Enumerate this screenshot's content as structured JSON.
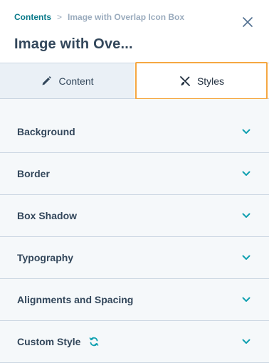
{
  "breadcrumb": {
    "parent": "Contents",
    "separator": ">",
    "current": "Image with Overlap Icon Box"
  },
  "title": "Image with Ove...",
  "tabs": [
    {
      "label": "Content",
      "icon": "pencil-icon",
      "active": false
    },
    {
      "label": "Styles",
      "icon": "brush-cross-icon",
      "active": true
    }
  ],
  "sections": [
    {
      "label": "Background",
      "icon": "chevron-down-icon"
    },
    {
      "label": "Border",
      "icon": "chevron-down-icon"
    },
    {
      "label": "Box Shadow",
      "icon": "chevron-down-icon"
    },
    {
      "label": "Typography",
      "icon": "chevron-down-icon"
    },
    {
      "label": "Alignments and Spacing",
      "icon": "chevron-down-icon"
    },
    {
      "label": "Custom Style",
      "icon": "chevron-down-icon",
      "badge_icon": "sync-icon"
    }
  ],
  "colors": {
    "accent": "#0b7a8a",
    "chevron": "#0fa0b0",
    "focus_outline": "#f5a742",
    "text": "#33475b",
    "divider": "#cbd6e2",
    "panel_bg": "#f5f8fa"
  }
}
